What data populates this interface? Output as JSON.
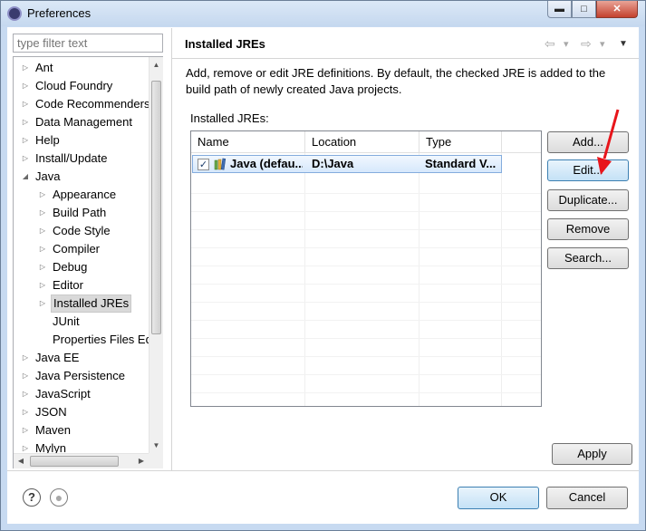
{
  "window": {
    "title": "Preferences",
    "min_glyph": "▬",
    "max_glyph": "□",
    "close_glyph": "✕"
  },
  "filter": {
    "placeholder": "type filter text"
  },
  "tree": {
    "items": [
      {
        "label": "Ant",
        "state": "collapsed"
      },
      {
        "label": "Cloud Foundry",
        "state": "collapsed"
      },
      {
        "label": "Code Recommenders",
        "state": "collapsed"
      },
      {
        "label": "Data Management",
        "state": "collapsed"
      },
      {
        "label": "Help",
        "state": "collapsed"
      },
      {
        "label": "Install/Update",
        "state": "collapsed"
      },
      {
        "label": "Java",
        "state": "expanded"
      },
      {
        "label": "Appearance",
        "state": "collapsed"
      },
      {
        "label": "Build Path",
        "state": "collapsed"
      },
      {
        "label": "Code Style",
        "state": "collapsed"
      },
      {
        "label": "Compiler",
        "state": "collapsed"
      },
      {
        "label": "Debug",
        "state": "collapsed"
      },
      {
        "label": "Editor",
        "state": "collapsed"
      },
      {
        "label": "Installed JREs",
        "state": "collapsed",
        "selected": true
      },
      {
        "label": "JUnit",
        "state": "leaf"
      },
      {
        "label": "Properties Files Ed",
        "state": "leaf"
      },
      {
        "label": "Java EE",
        "state": "collapsed"
      },
      {
        "label": "Java Persistence",
        "state": "collapsed"
      },
      {
        "label": "JavaScript",
        "state": "collapsed"
      },
      {
        "label": "JSON",
        "state": "collapsed"
      },
      {
        "label": "Maven",
        "state": "collapsed"
      },
      {
        "label": "Mylyn",
        "state": "collapsed"
      }
    ]
  },
  "page": {
    "title": "Installed JREs",
    "description": "Add, remove or edit JRE definitions. By default, the checked JRE is added to the build path of newly created Java projects.",
    "list_label": "Installed JREs:",
    "nav": {
      "back": "⇦",
      "forward": "⇨",
      "dropdown": "▾",
      "menu": "▼"
    }
  },
  "jre_table": {
    "columns": [
      "Name",
      "Location",
      "Type"
    ],
    "rows": [
      {
        "checked": true,
        "name": "Java (defau...",
        "location": "D:\\Java",
        "type": "Standard V..."
      }
    ]
  },
  "buttons": {
    "add": "Add...",
    "edit": "Edit...",
    "duplicate": "Duplicate...",
    "remove": "Remove",
    "search": "Search...",
    "apply": "Apply",
    "ok": "OK",
    "cancel": "Cancel"
  },
  "footer": {
    "help_glyph": "?",
    "import_glyph": "●"
  },
  "colors": {
    "annotation_arrow": "#e8151b",
    "selection": "#cce4f7",
    "accent_border": "#3c7fb1"
  },
  "checkmark": "✓"
}
